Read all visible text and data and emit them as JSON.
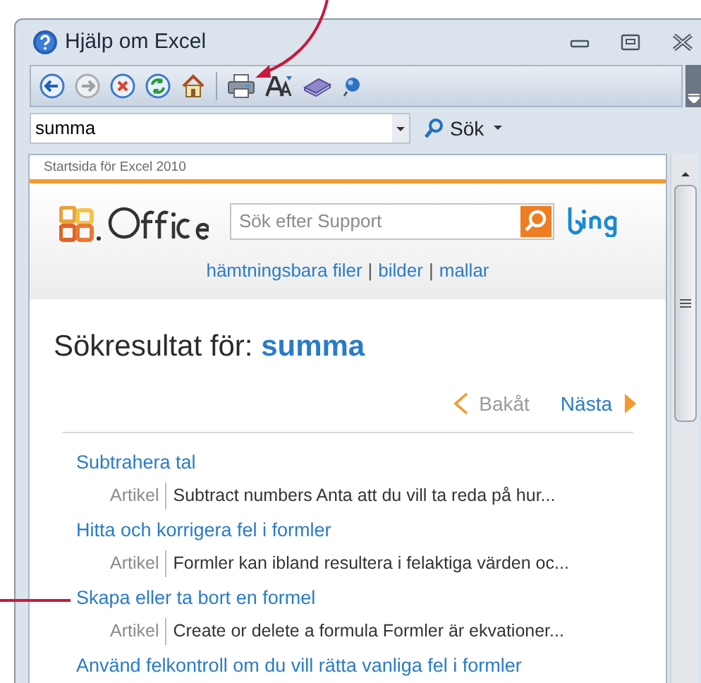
{
  "window": {
    "title": "Hjälp om Excel"
  },
  "search": {
    "value": "summa",
    "button": "Sök"
  },
  "breadcrumb": "Startsida för Excel 2010",
  "support_search": {
    "placeholder": "Sök efter Support"
  },
  "header_links": [
    "hämtningsbara filer",
    "bilder",
    "mallar"
  ],
  "link_separator": "|",
  "results_heading": {
    "label": "Sökresultat för:",
    "query": "summa"
  },
  "pager": {
    "back": "Bakåt",
    "next": "Nästa",
    "back_disabled": true
  },
  "results": [
    {
      "title": "Subtrahera tal",
      "type": "Artikel",
      "snippet": "Subtract numbers Anta att du vill ta reda på hur..."
    },
    {
      "title": "Hitta och korrigera fel i formler",
      "type": "Artikel",
      "snippet": "Formler kan ibland resultera i felaktiga värden oc..."
    },
    {
      "title": "Skapa eller ta bort en formel",
      "type": "Artikel",
      "snippet": "Create or delete a formula Formler är ekvationer..."
    },
    {
      "title": "Använd felkontroll om du vill rätta vanliga fel i formler"
    }
  ]
}
